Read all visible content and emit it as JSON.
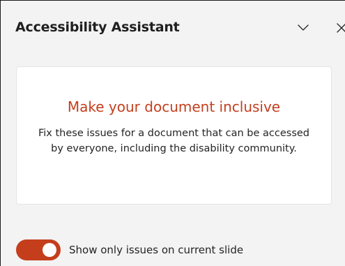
{
  "pane": {
    "title": "Accessibility Assistant",
    "collapse_icon": "chevron-down-icon",
    "close_icon": "close-icon"
  },
  "card": {
    "title": "Make your document inclusive",
    "description": "Fix these issues for a document that can be accessed by everyone, including the disability community."
  },
  "toggle": {
    "label": "Show only issues on current slide",
    "state": "on"
  },
  "colors": {
    "accent": "#c43e1c",
    "pane_background": "#f3f3f3",
    "card_background": "#ffffff",
    "text": "#242424"
  }
}
